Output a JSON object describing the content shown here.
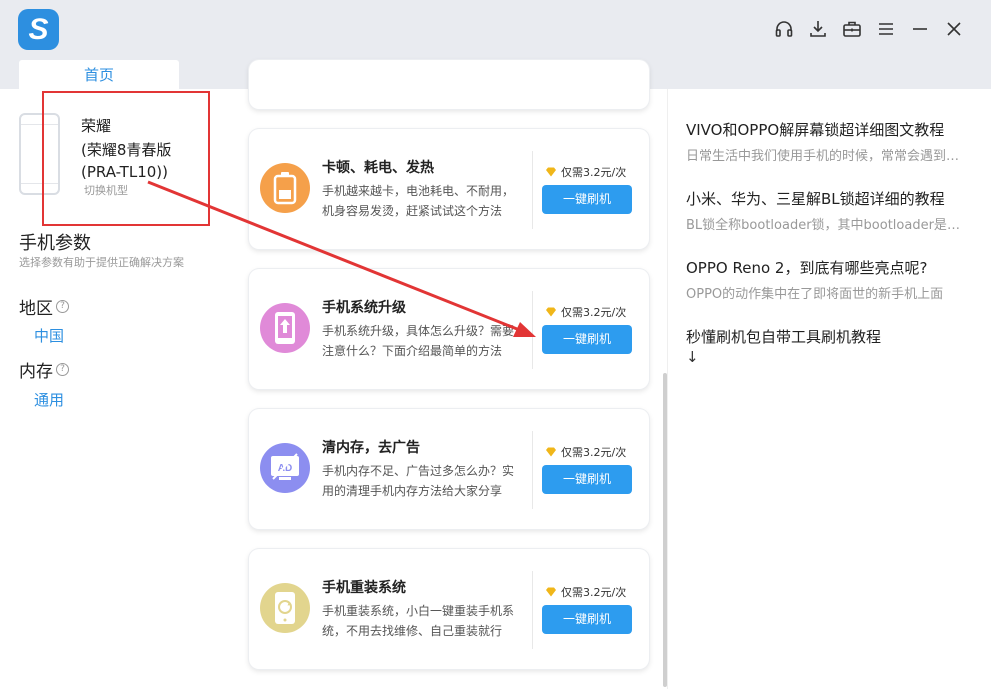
{
  "app": {
    "tab_home": "首页",
    "top_icons": [
      "headset-icon",
      "download-icon",
      "toolbox-icon",
      "menu-icon",
      "minimize-icon",
      "close-icon"
    ]
  },
  "device": {
    "brand": "荣耀",
    "model": "(荣耀8青春版(PRA-TL10))",
    "switch_label": "切换机型"
  },
  "params": {
    "title": "手机参数",
    "subtitle": "选择参数有助于提供正确解决方案",
    "region_label": "地区",
    "region_value": "中国",
    "memory_label": "内存",
    "memory_value": "通用",
    "help_glyph": "?"
  },
  "cards": [
    {
      "title": "卡顿、耗电、发热",
      "desc": "手机越来越卡，电池耗电、不耐用，机身容易发烫，赶紧试试这个方法",
      "price": "仅需3.2元/次",
      "button": "一键刷机",
      "icon": "battery-icon",
      "color": "#f5a04a"
    },
    {
      "title": "手机系统升级",
      "desc": "手机系统升级，具体怎么升级？需要注意什么？下面介绍最简单的方法",
      "price": "仅需3.2元/次",
      "button": "一键刷机",
      "icon": "phone-upgrade-icon",
      "color": "#e08ad8"
    },
    {
      "title": "清内存，去广告",
      "desc": "手机内存不足、广告过多怎么办？实用的清理手机内存方法给大家分享",
      "price": "仅需3.2元/次",
      "button": "一键刷机",
      "icon": "ad-block-icon",
      "color": "#8c8ef0"
    },
    {
      "title": "手机重装系统",
      "desc": "手机重装系统，小白一键重装手机系统，不用去找维修、自己重装就行",
      "price": "仅需3.2元/次",
      "button": "一键刷机",
      "icon": "phone-reinstall-icon",
      "color": "#e2d58e"
    }
  ],
  "articles": [
    {
      "title": "VIVO和OPPO解屏幕锁超详细图文教程",
      "summary": "日常生活中我们使用手机的时候，常常会遇到忘记锁屏密码"
    },
    {
      "title": "小米、华为、三星解BL锁超详细的教程",
      "summary": "BL锁全称bootloader锁，其中bootloader是引导程序"
    },
    {
      "title": "OPPO Reno 2，到底有哪些亮点呢?",
      "summary": "OPPO的动作集中在了即将面世的新手机上面"
    },
    {
      "title": "秒懂刷机包自带工具刷机教程",
      "summary": "↓"
    }
  ]
}
